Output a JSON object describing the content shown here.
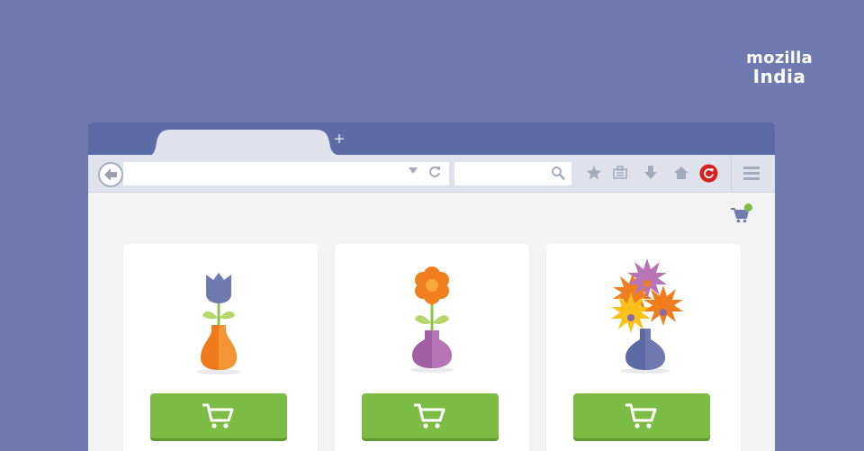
{
  "brand": {
    "line1": "mozilla",
    "line2": "India"
  },
  "browser": {
    "tab_close_glyph": "×",
    "new_tab_glyph": "+",
    "toolbar_icons": [
      "back-arrow-icon",
      "url-dropdown-icon",
      "reload-icon",
      "search-icon",
      "bookmark-star-icon",
      "reading-list-icon",
      "download-icon",
      "home-icon",
      "pocket-sync-icon",
      "hamburger-menu-icon"
    ]
  },
  "shop": {
    "cart_badge_color": "#7cbc45",
    "products": [
      {
        "name": "tulip-vase",
        "button_icon": "cart-icon"
      },
      {
        "name": "orange-flower-vase",
        "button_icon": "cart-icon"
      },
      {
        "name": "bouquet-vase",
        "button_icon": "cart-icon"
      }
    ]
  },
  "colors": {
    "background": "#6f7bb0",
    "accent_green": "#7cbc45",
    "tab_strip": "#5c6aa5"
  }
}
